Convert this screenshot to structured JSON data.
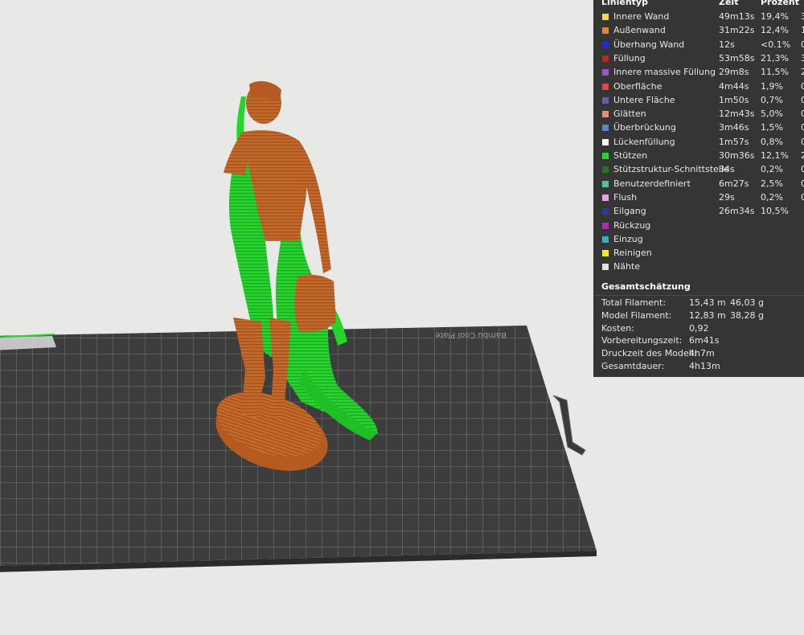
{
  "legend": {
    "headers": {
      "type": "Linientyp",
      "time": "Zeit",
      "percent": "Prozent",
      "extra": ""
    },
    "rows": [
      {
        "color": "#f2d84a",
        "name": "Innere Wand",
        "time": "49m13s",
        "percent": "19,4%",
        "extra": "3"
      },
      {
        "color": "#e6813e",
        "name": "Außenwand",
        "time": "31m22s",
        "percent": "12,4%",
        "extra": "1"
      },
      {
        "color": "#1f2fd6",
        "name": "Überhang Wand",
        "time": "12s",
        "percent": "<0.1%",
        "extra": "0"
      },
      {
        "color": "#b02a2a",
        "name": "Füllung",
        "time": "53m58s",
        "percent": "21,3%",
        "extra": "3"
      },
      {
        "color": "#9a57c9",
        "name": "Innere massive Füllung",
        "time": "29m8s",
        "percent": "11,5%",
        "extra": "2"
      },
      {
        "color": "#e04848",
        "name": "Oberfläche",
        "time": "4m44s",
        "percent": "1,9%",
        "extra": "0"
      },
      {
        "color": "#6a5bb0",
        "name": "Untere Fläche",
        "time": "1m50s",
        "percent": "0,7%",
        "extra": "0"
      },
      {
        "color": "#f08a72",
        "name": "Glätten",
        "time": "12m43s",
        "percent": "5,0%",
        "extra": "0"
      },
      {
        "color": "#5a84c6",
        "name": "Überbrückung",
        "time": "3m46s",
        "percent": "1,5%",
        "extra": "0"
      },
      {
        "color": "#ffffff",
        "name": "Lückenfüllung",
        "time": "1m57s",
        "percent": "0,8%",
        "extra": "0"
      },
      {
        "color": "#22d62a",
        "name": "Stützen",
        "time": "30m36s",
        "percent": "12,1%",
        "extra": "2"
      },
      {
        "color": "#1e7a1e",
        "name": "Stützstruktur-Schnittstelle",
        "time": "34s",
        "percent": "0,2%",
        "extra": "0"
      },
      {
        "color": "#52c29a",
        "name": "Benutzerdefiniert",
        "time": "6m27s",
        "percent": "2,5%",
        "extra": "0"
      },
      {
        "color": "#e8a2e4",
        "name": "Flush",
        "time": "29s",
        "percent": "0,2%",
        "extra": "0"
      },
      {
        "color": "#2a3d8f",
        "name": "Eilgang",
        "time": "26m34s",
        "percent": "10,5%",
        "extra": ""
      },
      {
        "color": "#b02ab8",
        "name": "Rückzug",
        "time": "",
        "percent": "",
        "extra": ""
      },
      {
        "color": "#3fa7c8",
        "name": "Einzug",
        "time": "",
        "percent": "",
        "extra": ""
      },
      {
        "color": "#ffe81a",
        "name": "Reinigen",
        "time": "",
        "percent": "",
        "extra": ""
      },
      {
        "color": "#e0e0e0",
        "name": "Nähte",
        "time": "",
        "percent": "",
        "extra": ""
      }
    ]
  },
  "summary": {
    "title": "Gesamtschätzung",
    "rows": [
      {
        "label": "Total Filament:",
        "v1": "15,43 m",
        "v2": "46,03 g"
      },
      {
        "label": "Model Filament:",
        "v1": "12,83 m",
        "v2": "38,28 g"
      },
      {
        "label": "Kosten:",
        "v1": "0,92",
        "v2": ""
      },
      {
        "label": "Vorbereitungszeit:",
        "v1": "6m41s",
        "v2": ""
      },
      {
        "label": "Druckzeit des Modell:",
        "v1": "4h7m",
        "v2": ""
      },
      {
        "label": "Gesamtdauer:",
        "v1": "4h13m",
        "v2": ""
      }
    ]
  },
  "plate": {
    "label": "Bambu Cool Plate"
  },
  "colors": {
    "model": "#c46a2c",
    "support": "#22d62a",
    "plate": "#3d3d3d",
    "panel_bg": "#353535"
  }
}
